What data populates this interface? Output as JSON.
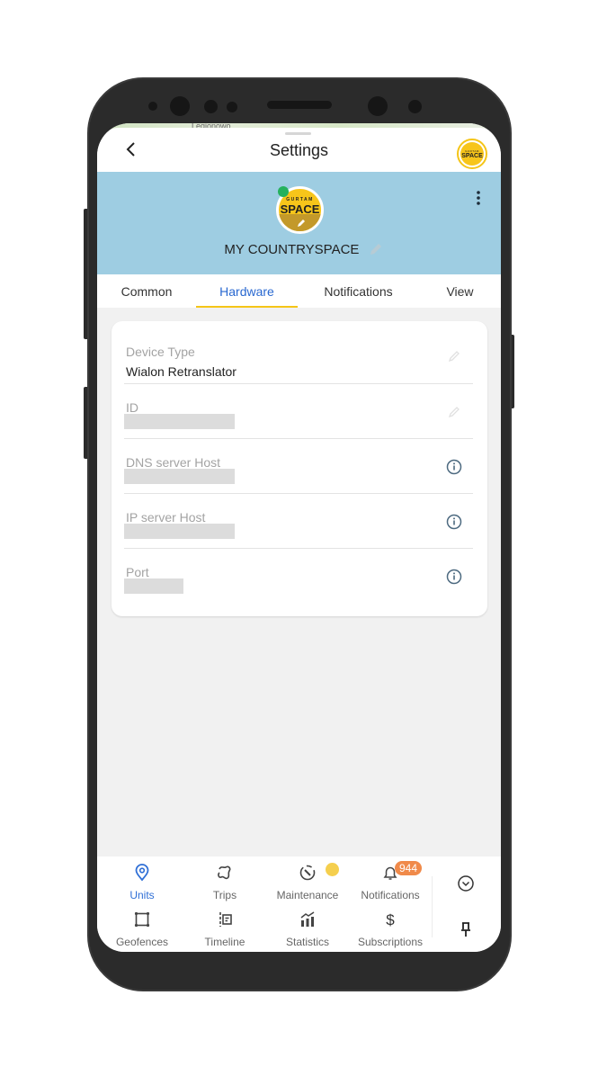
{
  "app": {
    "title": "Settings",
    "map_label": "Legionowo",
    "brand_logo": {
      "top_text": "GURTAM",
      "main_text": "SPACE",
      "color": "#F7C51A"
    }
  },
  "unit": {
    "name": "MY COUNTRYSPACE",
    "online_status_color": "#25B15D",
    "avatar": {
      "top_text": "GURTAM",
      "main_text": "SPACE"
    }
  },
  "tabs": [
    {
      "label": "Common",
      "active": false
    },
    {
      "label": "Hardware",
      "active": true
    },
    {
      "label": "Notifications",
      "active": false
    },
    {
      "label": "View",
      "active": false
    }
  ],
  "hardware": {
    "fields": [
      {
        "label": "Device Type",
        "value": "Wialon Retranslator",
        "action_icon": "pencil-icon"
      },
      {
        "label": "ID",
        "value": "",
        "action_icon": "pencil-icon"
      },
      {
        "label": "DNS server Host",
        "value": "",
        "action_icon": "info-icon"
      },
      {
        "label": "IP server Host",
        "value": "",
        "action_icon": "info-icon"
      },
      {
        "label": "Port",
        "value": "",
        "action_icon": "info-icon"
      }
    ]
  },
  "bottom_nav": {
    "items": [
      {
        "label": "Units",
        "icon": "location-pin-icon",
        "active": true
      },
      {
        "label": "Trips",
        "icon": "route-icon",
        "active": false
      },
      {
        "label": "Maintenance",
        "icon": "wrench-clock-icon",
        "active": false
      },
      {
        "label": "Notifications",
        "icon": "bell-icon",
        "active": false,
        "badge": "944"
      },
      {
        "label": "Geofences",
        "icon": "geofence-square-icon",
        "active": false
      },
      {
        "label": "Timeline",
        "icon": "timeline-icon",
        "active": false
      },
      {
        "label": "Statistics",
        "icon": "bar-chart-icon",
        "active": false
      },
      {
        "label": "Subscriptions",
        "icon": "dollar-icon",
        "active": false
      }
    ]
  },
  "colors": {
    "accent_blue": "#2968D0",
    "tab_underline": "#F5C518",
    "header_bg": "#9ECDE2",
    "badge_orange": "#F08A4A"
  }
}
